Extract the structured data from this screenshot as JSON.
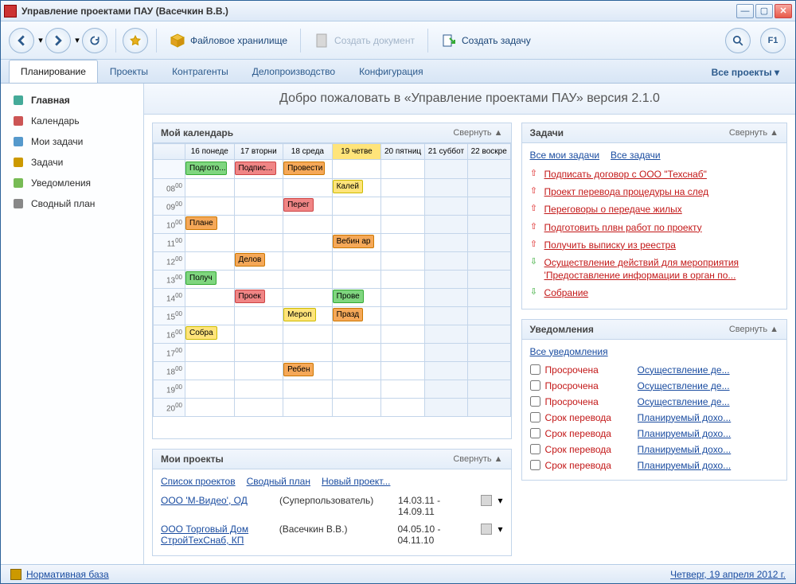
{
  "window": {
    "title": "Управление проектами ПАУ (Васечкин В.В.)"
  },
  "toolbar": {
    "file_storage": "Файловое хранилище",
    "create_doc": "Создать документ",
    "create_task": "Создать задачу"
  },
  "tabs": {
    "items": [
      "Планирование",
      "Проекты",
      "Контрагенты",
      "Делопроизводство",
      "Конфигурация"
    ],
    "all_projects": "Все проекты"
  },
  "sidebar": {
    "items": [
      {
        "label": "Главная"
      },
      {
        "label": "Календарь"
      },
      {
        "label": "Мои задачи"
      },
      {
        "label": "Задачи"
      },
      {
        "label": "Уведомления"
      },
      {
        "label": "Сводный план"
      }
    ]
  },
  "welcome": "Добро пожаловать в «Управление проектами ПАУ» версия 2.1.0",
  "calendar": {
    "title": "Мой календарь",
    "collapse": "Свернуть ▲",
    "days": [
      "16 понеде",
      "17 вторни",
      "18 среда",
      "19 четве",
      "20 пятниц",
      "21 суббот",
      "22 воскре"
    ],
    "times": [
      "08",
      "09",
      "10",
      "11",
      "12",
      "13",
      "14",
      "15",
      "16",
      "17",
      "18",
      "19",
      "20"
    ],
    "allday": [
      {
        "col": 0,
        "label": "Подгото...",
        "cls": "ev-green"
      },
      {
        "col": 1,
        "label": "Подпис...",
        "cls": "ev-red"
      },
      {
        "col": 2,
        "label": "Провести",
        "cls": "ev-orange"
      }
    ],
    "events": [
      {
        "time": "08",
        "col": 3,
        "label": "Калей",
        "cls": "ev-yellow"
      },
      {
        "time": "09",
        "col": 2,
        "label": "Перег",
        "cls": "ev-red"
      },
      {
        "time": "10",
        "col": 0,
        "label": "Плане",
        "cls": "ev-orange"
      },
      {
        "time": "11",
        "col": 3,
        "label": "Вебин ар",
        "cls": "ev-orange"
      },
      {
        "time": "12",
        "col": 1,
        "label": "Делов",
        "cls": "ev-orange"
      },
      {
        "time": "13",
        "col": 0,
        "label": "Получ",
        "cls": "ev-green"
      },
      {
        "time": "14",
        "col": 1,
        "label": "Проек",
        "cls": "ev-red"
      },
      {
        "time": "14",
        "col": 3,
        "label": "Прове",
        "cls": "ev-green"
      },
      {
        "time": "15",
        "col": 2,
        "label": "Мероп",
        "cls": "ev-yellow"
      },
      {
        "time": "15",
        "col": 3,
        "label": "Празд",
        "cls": "ev-orange"
      },
      {
        "time": "16",
        "col": 0,
        "label": "Собра",
        "cls": "ev-yellow"
      },
      {
        "time": "18",
        "col": 2,
        "label": "Ребен",
        "cls": "ev-orange"
      }
    ]
  },
  "projects": {
    "title": "Мои проекты",
    "collapse": "Свернуть ▲",
    "links": [
      "Список проектов",
      "Сводный план",
      "Новый проект..."
    ],
    "items": [
      {
        "name": "ООО 'М-Видео', ОД",
        "user": "(Суперпользователь)",
        "dates": "14.03.11 - 14.09.11"
      },
      {
        "name": "ООО Торговый Дом СтройТехСнаб, КП",
        "user": "(Васечкин В.В.)",
        "dates": "04.05.10 - 04.11.10"
      }
    ]
  },
  "tasks": {
    "title": "Задачи",
    "collapse": "Свернуть ▲",
    "links": [
      "Все мои задачи",
      "Все задачи"
    ],
    "items": [
      {
        "dir": "up",
        "text": "Подписать договор с ООО \"Техснаб\""
      },
      {
        "dir": "up",
        "text": "Проект перевода процедуры на след"
      },
      {
        "dir": "up",
        "text": "Переговоры о передаче жилых"
      },
      {
        "dir": "up",
        "text": "Подготовить плвн работ по проекту"
      },
      {
        "dir": "up",
        "text": "Получить выписку из реестра"
      },
      {
        "dir": "down",
        "text": "Осуществление действий для мероприятия 'Предоставление информации в орган по..."
      },
      {
        "dir": "down",
        "text": "Собрание"
      }
    ]
  },
  "notifications": {
    "title": "Уведомления",
    "collapse": "Свернуть ▲",
    "link": "Все уведомления",
    "items": [
      {
        "status": "Просрочена",
        "link": "Осуществление де..."
      },
      {
        "status": "Просрочена",
        "link": "Осуществление де..."
      },
      {
        "status": "Просрочена",
        "link": "Осуществление де..."
      },
      {
        "status": "Срок перевода",
        "link": "Планируемый дохо..."
      },
      {
        "status": "Срок перевода",
        "link": "Планируемый дохо..."
      },
      {
        "status": "Срок перевода",
        "link": "Планируемый дохо..."
      },
      {
        "status": "Срок перевода",
        "link": "Планируемый дохо..."
      }
    ]
  },
  "statusbar": {
    "left": "Нормативная база",
    "right": "Четверг, 19 апреля 2012 г."
  }
}
